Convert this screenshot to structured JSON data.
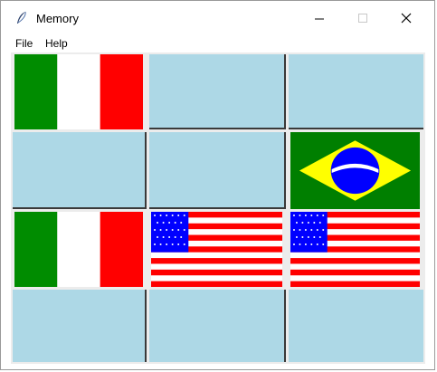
{
  "window": {
    "title": "Memory",
    "controls": {
      "minimize": "–",
      "maximize": "□",
      "close": "✕"
    }
  },
  "menu": {
    "items": [
      "File",
      "Help"
    ]
  },
  "board": {
    "rows": 4,
    "cols": 3,
    "cells": [
      {
        "state": "revealed",
        "flag": "italy"
      },
      {
        "state": "hidden"
      },
      {
        "state": "hidden"
      },
      {
        "state": "hidden"
      },
      {
        "state": "hidden"
      },
      {
        "state": "revealed",
        "flag": "brazil"
      },
      {
        "state": "revealed",
        "flag": "italy"
      },
      {
        "state": "revealed",
        "flag": "usa"
      },
      {
        "state": "revealed",
        "flag": "usa"
      },
      {
        "state": "hidden"
      },
      {
        "state": "hidden"
      },
      {
        "state": "hidden"
      }
    ]
  },
  "colors": {
    "tile_back": "#add8e6",
    "italy": [
      "#008c00",
      "#ffffff",
      "#ff0000"
    ],
    "brazil": {
      "green": "#007f00",
      "yellow": "#ffff00",
      "blue": "#0000ff"
    },
    "usa": {
      "red": "#ff0000",
      "white": "#ffffff",
      "blue": "#0000ff"
    }
  },
  "icons": {
    "app": "feather-icon"
  }
}
